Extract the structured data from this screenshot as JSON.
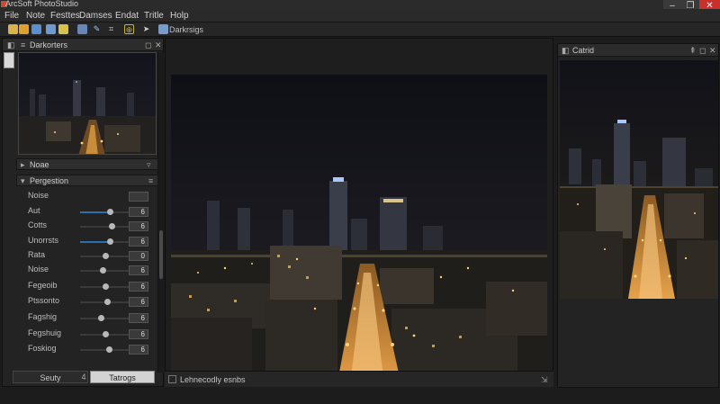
{
  "app": {
    "title": "ArcSoft PhotoStudio"
  },
  "window_controls": {
    "minimize": "–",
    "maximize": "❐",
    "close": "✕"
  },
  "menu": [
    "File",
    "Note",
    "Festtes",
    "Damses",
    "Endat",
    "Tritle",
    "Holp"
  ],
  "toolbar": {
    "path_label": "Darkrsigs"
  },
  "left_panel": {
    "title": "Darkorters",
    "section_noise": "Noae",
    "section_adjust": "Pergestion",
    "adjustments": [
      {
        "label": "Noise",
        "value": "",
        "level": null
      },
      {
        "label": "Aut",
        "value": "6",
        "level": 0.52
      },
      {
        "label": "Cotts",
        "value": "6",
        "level": 0.55
      },
      {
        "label": "Unorrsts",
        "value": "6",
        "level": 0.52
      },
      {
        "label": "Rata",
        "value": "0",
        "level": 0.45
      },
      {
        "label": "Noise",
        "value": "6",
        "level": 0.4
      },
      {
        "label": "Fegeoib",
        "value": "6",
        "level": 0.45
      },
      {
        "label": "Ptssonto",
        "value": "6",
        "level": 0.47
      },
      {
        "label": "Fagshig",
        "value": "6",
        "level": 0.37
      },
      {
        "label": "Fegshuig",
        "value": "6",
        "level": 0.45
      },
      {
        "label": "Foskiog",
        "value": "6",
        "level": 0.5
      }
    ],
    "tabs": {
      "left": "Seuty",
      "mid": "4",
      "right": "Tatrogs"
    }
  },
  "status": {
    "text": "Lehnecodly esnbs"
  },
  "right_panel": {
    "title": "Catrid"
  }
}
